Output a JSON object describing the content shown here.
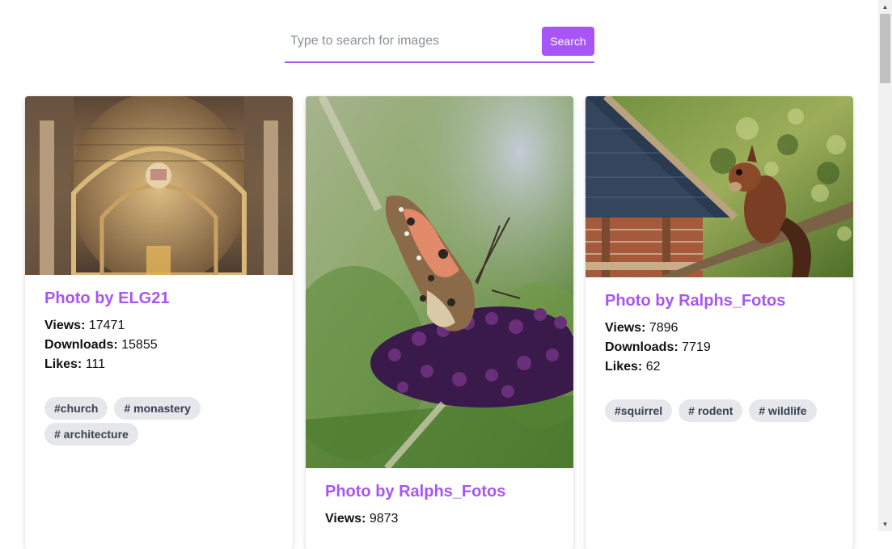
{
  "search": {
    "placeholder": "Type to search for images",
    "value": "",
    "button_label": "Search"
  },
  "stat_labels": {
    "views": "Views:",
    "downloads": "Downloads:",
    "likes": "Likes:"
  },
  "cards": [
    {
      "title": "Photo by ELG21",
      "image_subject": "ornate church ceiling",
      "views": "17471",
      "downloads": "15855",
      "likes": "111",
      "tags": [
        "#church",
        "# monastery",
        "# architecture"
      ]
    },
    {
      "title": "Photo by Ralphs_Fotos",
      "image_subject": "butterfly on purple flower",
      "views": "9873"
    },
    {
      "title": "Photo by Ralphs_Fotos",
      "image_subject": "squirrel beside bird feeder",
      "views": "7896",
      "downloads": "7719",
      "likes": "62",
      "tags": [
        "#squirrel",
        "# rodent",
        "# wildlife"
      ]
    }
  ],
  "colors": {
    "accent": "#a855f7",
    "tag_bg": "#e5e7eb",
    "tag_text": "#374151"
  }
}
